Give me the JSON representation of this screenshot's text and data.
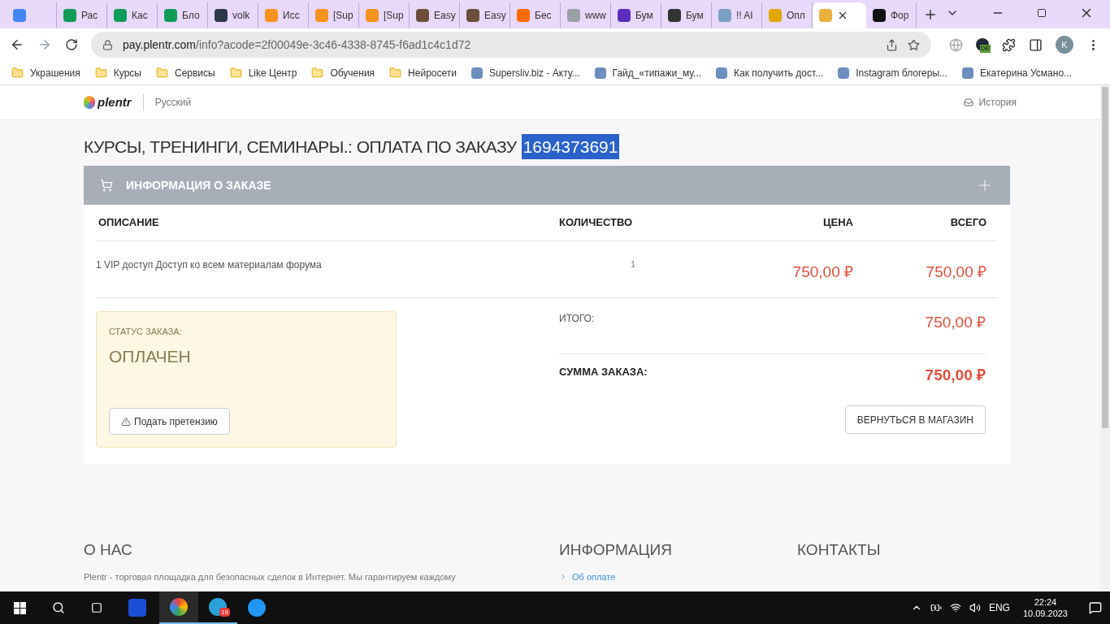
{
  "browser": {
    "tabs": [
      {
        "selected": false
      },
      {
        "title": "Рас",
        "selected": false
      },
      {
        "title": "Кас",
        "selected": false
      },
      {
        "title": "Бло",
        "selected": false
      },
      {
        "title": "volk",
        "selected": false
      },
      {
        "title": "Исс",
        "selected": false
      },
      {
        "title": "[Sup",
        "selected": false
      },
      {
        "title": "[Sup",
        "selected": false
      },
      {
        "title": "Easy",
        "selected": false
      },
      {
        "title": "Easy",
        "selected": false
      },
      {
        "title": "Бес",
        "selected": false
      },
      {
        "title": "www",
        "selected": false
      },
      {
        "title": "Бум",
        "selected": false
      },
      {
        "title": "Бум",
        "selected": false
      },
      {
        "title": "!! AI",
        "selected": false
      },
      {
        "title": "Опл",
        "selected": false
      },
      {
        "selected": true
      },
      {
        "title": "Фор",
        "selected": false
      }
    ],
    "url_host": "pay.plentr.com",
    "url_path": "/info?acode=2f00049e-3c46-4338-8745-f6ad1c4c1d72",
    "profile_initial": "K",
    "extension_badge": "DE",
    "bookmarks": [
      {
        "label": "Украшения",
        "kind": "folder"
      },
      {
        "label": "Курсы",
        "kind": "folder"
      },
      {
        "label": "Сервисы",
        "kind": "folder"
      },
      {
        "label": "Like Центр",
        "kind": "folder"
      },
      {
        "label": "Обучения",
        "kind": "folder"
      },
      {
        "label": "Нейросети",
        "kind": "folder"
      },
      {
        "label": "Supersliv.biz - Акту...",
        "kind": "site"
      },
      {
        "label": "Гайд_«типажи_му...",
        "kind": "site"
      },
      {
        "label": "Как получить дост...",
        "kind": "site"
      },
      {
        "label": "Instagram блогеры...",
        "kind": "site"
      },
      {
        "label": "Екатерина Усмано...",
        "kind": "site"
      }
    ]
  },
  "site": {
    "logo": "plentr",
    "language": "Русский",
    "history": "История"
  },
  "page": {
    "title": "КУРСЫ, ТРЕНИНГИ, СЕМИНАРЫ.: ОПЛАТА ПО ЗАКАЗУ",
    "order_number": "1694373691",
    "panel_title": "ИНФОРМАЦИЯ О ЗАКАЗЕ",
    "table": {
      "columns": [
        "ОПИСАНИЕ",
        "КОЛИЧЕСТВО",
        "ЦЕНА",
        "ВСЕГО"
      ],
      "rows": [
        {
          "description": "1 VIP доступ Доступ ко всем материалам форума",
          "quantity": "1",
          "price": "750,00 ₽",
          "total": "750,00 ₽"
        }
      ]
    },
    "status": {
      "label": "СТАТУС ЗАКАЗА:",
      "value": "ОПЛАЧЕН",
      "button": "Подать претензию"
    },
    "totals": [
      {
        "label": "ИТОГО:",
        "value": "750,00 ₽",
        "bold": false
      },
      {
        "label": "СУММА ЗАКАЗА:",
        "value": "750,00 ₽",
        "bold": true
      }
    ],
    "back_button": "ВЕРНУТЬСЯ В МАГАЗИН"
  },
  "footer": {
    "columns": [
      {
        "heading": "О НАС",
        "text": "Plentr - торговая площадка для безопасных сделок в Интернет. Мы гарантируем каждому"
      },
      {
        "heading": "ИНФОРМАЦИЯ",
        "link": "Об оплате"
      },
      {
        "heading": "КОНТАКТЫ"
      }
    ]
  },
  "taskbar": {
    "telegram_badge": "19",
    "language": "ENG",
    "time": "22:24",
    "date": "10.09.2023"
  }
}
